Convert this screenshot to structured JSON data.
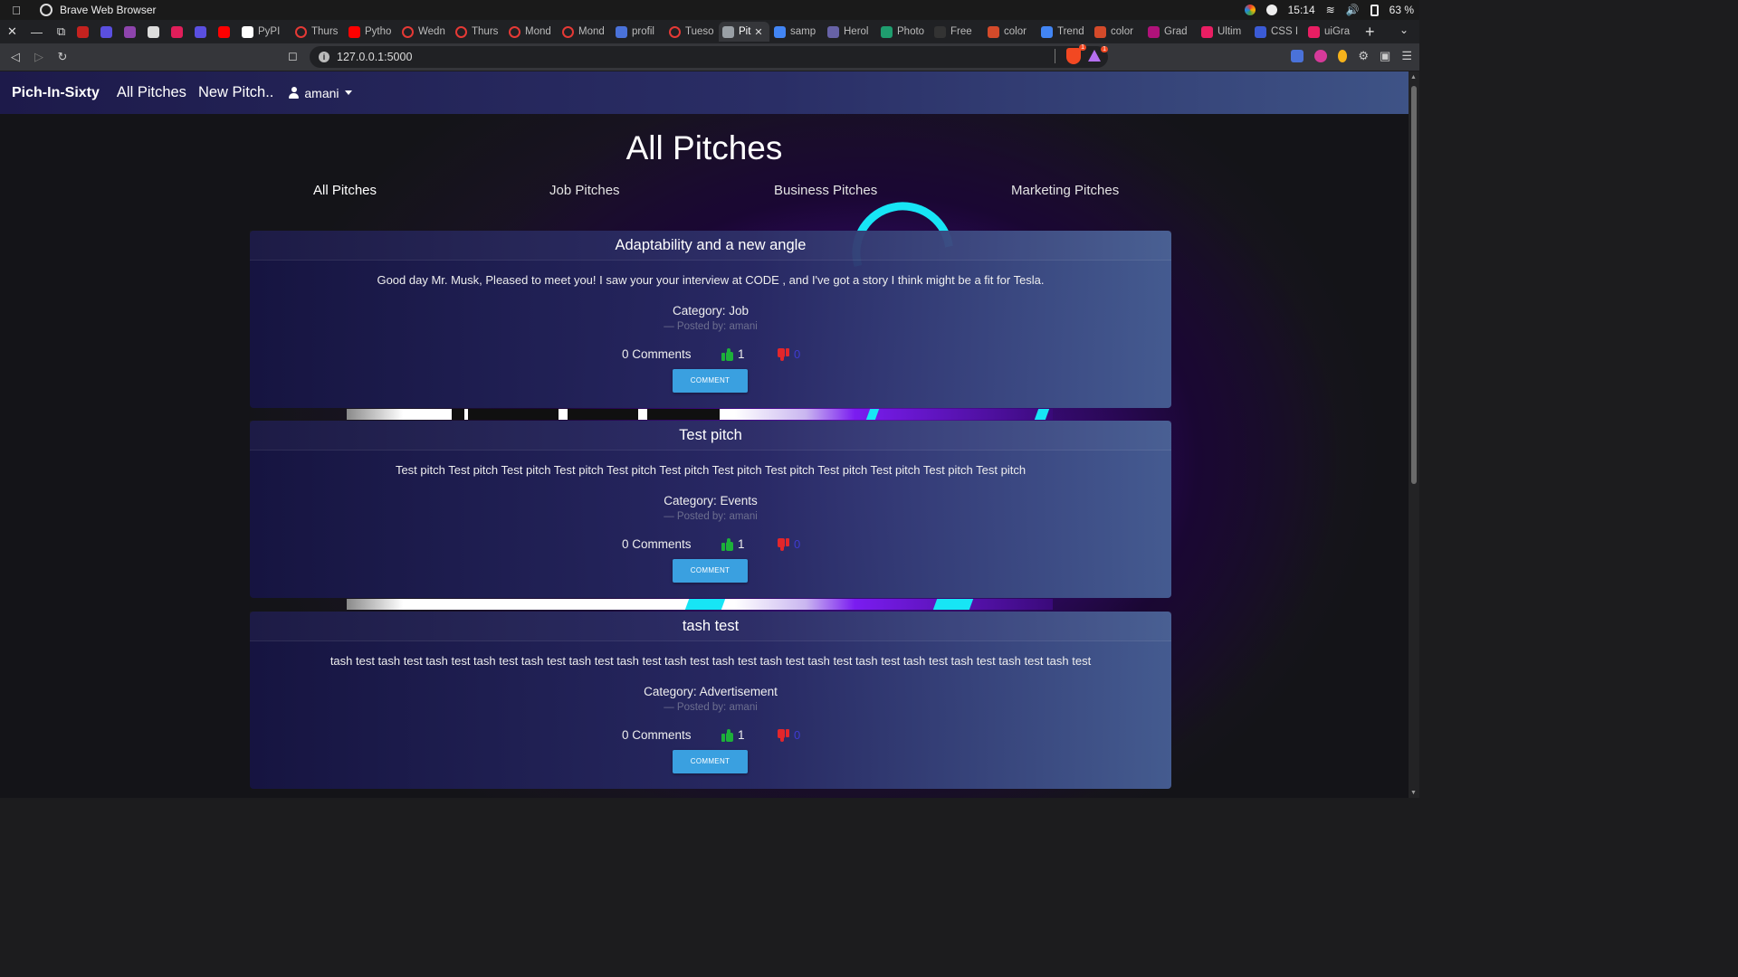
{
  "os": {
    "app_title": "Brave Web Browser",
    "clock": "15:14",
    "battery": "63 %"
  },
  "browser": {
    "tabs": [
      {
        "label": "",
        "icon": "gmail-icon",
        "color": "#c5221f",
        "kind": "pin"
      },
      {
        "label": "",
        "icon": "docs-icon",
        "color": "#5a4fe0",
        "kind": "pin"
      },
      {
        "label": "",
        "icon": "gmail-icon",
        "color": "#8e44ad",
        "kind": "pin"
      },
      {
        "label": "",
        "icon": "github-icon",
        "color": "#dddddd",
        "kind": "pin"
      },
      {
        "label": "",
        "icon": "slack-icon",
        "color": "#e01e5a",
        "kind": "pin"
      },
      {
        "label": "",
        "icon": "docs-icon",
        "color": "#5a4fe0",
        "kind": "pin"
      },
      {
        "label": "",
        "icon": "youtube-icon",
        "color": "#ff0000",
        "kind": "pin"
      },
      {
        "label": "PyPI",
        "icon": "pypi-icon",
        "color": "#ffffff",
        "kind": "short"
      },
      {
        "label": "Thurs",
        "icon": "ring-icon",
        "color": "#e53935",
        "kind": "short"
      },
      {
        "label": "Pytho",
        "icon": "youtube-icon",
        "color": "#ff0000",
        "kind": "short"
      },
      {
        "label": "Wedn",
        "icon": "ring-icon",
        "color": "#e53935",
        "kind": "short"
      },
      {
        "label": "Thurs",
        "icon": "ring-icon",
        "color": "#e53935",
        "kind": "short"
      },
      {
        "label": "Mond",
        "icon": "ring-icon",
        "color": "#e53935",
        "kind": "short"
      },
      {
        "label": "Mond",
        "icon": "ring-icon",
        "color": "#e53935",
        "kind": "short"
      },
      {
        "label": "profil",
        "icon": "profile-icon",
        "color": "#4a72d9",
        "kind": "short"
      },
      {
        "label": "Tueso",
        "icon": "ring-icon",
        "color": "#e53935",
        "kind": "short"
      },
      {
        "label": "Pit",
        "icon": "globe-icon",
        "color": "#9aa0a6",
        "kind": "active"
      },
      {
        "label": "samp",
        "icon": "google-icon",
        "color": "#4285f4",
        "kind": "short"
      },
      {
        "label": "Herol",
        "icon": "heroku-icon",
        "color": "#6762a6",
        "kind": "short"
      },
      {
        "label": "Photo",
        "icon": "photo-icon",
        "color": "#1f9d6e",
        "kind": "short"
      },
      {
        "label": "Free",
        "icon": "free-icon",
        "color": "#333333",
        "kind": "short"
      },
      {
        "label": "color",
        "icon": "color-icon",
        "color": "#d44a2a",
        "kind": "short"
      },
      {
        "label": "Trend",
        "icon": "trend-icon",
        "color": "#4285f4",
        "kind": "short"
      },
      {
        "label": "color",
        "icon": "color-icon",
        "color": "#d44a2a",
        "kind": "short"
      },
      {
        "label": "Grad",
        "icon": "gradient-icon",
        "color": "#b0127a",
        "kind": "short"
      },
      {
        "label": "Ultim",
        "icon": "ultimate-icon",
        "color": "#e91e63",
        "kind": "short"
      },
      {
        "label": "CSS I",
        "icon": "css-icon",
        "color": "#3b5bd6",
        "kind": "short"
      },
      {
        "label": "uiGra",
        "icon": "uigradients-icon",
        "color": "#e91e63",
        "kind": "short"
      }
    ],
    "url": "127.0.0.1:5000",
    "shield_count": "1",
    "bat_count": "1"
  },
  "site": {
    "brand": "Pich-In-Sixty",
    "nav_links": [
      "All Pitches",
      "New Pitch.."
    ],
    "user": "amani",
    "heading": "All Pitches",
    "categories": [
      {
        "label": "All Pitches",
        "active": true
      },
      {
        "label": "Job Pitches",
        "active": false
      },
      {
        "label": "Business Pitches",
        "active": false
      },
      {
        "label": "Marketing Pitches",
        "active": false
      }
    ]
  },
  "pitches": [
    {
      "title": "Adaptability and a new angle",
      "body": "Good day Mr. Musk, Pleased to meet you! I saw your your interview at CODE , and I've got a story I think might be a fit for Tesla.",
      "category": "Category: Job",
      "posted_by": "— Posted by: amani",
      "comments": "0 Comments",
      "likes": "1",
      "dislikes": "0",
      "button": "COMMENT"
    },
    {
      "title": "Test pitch",
      "body": "Test pitch Test pitch Test pitch Test pitch Test pitch Test pitch Test pitch Test pitch Test pitch Test pitch Test pitch Test pitch",
      "category": "Category: Events",
      "posted_by": "— Posted by: amani",
      "comments": "0 Comments",
      "likes": "1",
      "dislikes": "0",
      "button": "COMMENT"
    },
    {
      "title": "tash test",
      "body": "tash test tash test tash test tash test tash test tash test tash test tash test tash test tash test tash test tash test tash test tash test tash test tash test",
      "category": "Category: Advertisement",
      "posted_by": "— Posted by: amani",
      "comments": "0 Comments",
      "likes": "1",
      "dislikes": "0",
      "button": "COMMENT"
    }
  ]
}
